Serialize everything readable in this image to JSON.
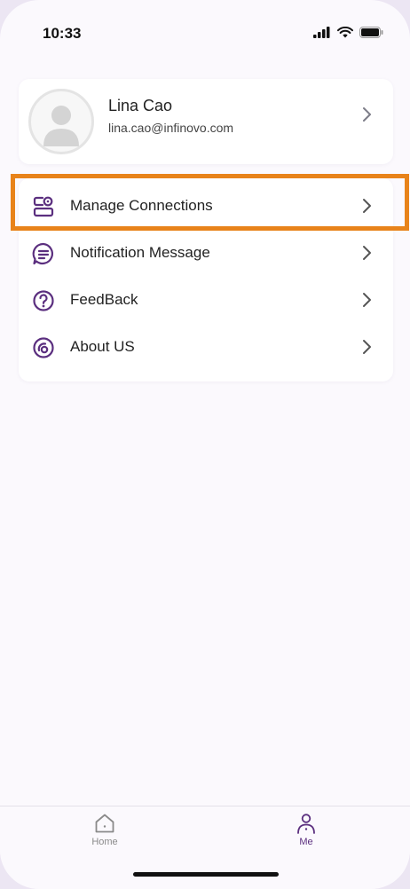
{
  "status_bar": {
    "time": "10:33",
    "icons": [
      "signal-icon",
      "wifi-icon",
      "battery-icon"
    ]
  },
  "profile": {
    "name": "Lina Cao",
    "email": "lina.cao@infinovo.com",
    "avatar_icon": "avatar-placeholder-icon"
  },
  "menu": {
    "items": [
      {
        "label": "Manage Connections",
        "icon": "connections-icon"
      },
      {
        "label": "Notification Message",
        "icon": "message-icon"
      },
      {
        "label": "FeedBack",
        "icon": "question-icon"
      },
      {
        "label": "About US",
        "icon": "about-icon"
      }
    ]
  },
  "tabbar": {
    "tabs": [
      {
        "label": "Home",
        "icon": "home-icon",
        "active": false
      },
      {
        "label": "Me",
        "icon": "person-icon",
        "active": true
      }
    ]
  },
  "colors": {
    "accent": "#5b2f7f",
    "highlight": "#e8831a",
    "background": "#fbf9fd"
  }
}
